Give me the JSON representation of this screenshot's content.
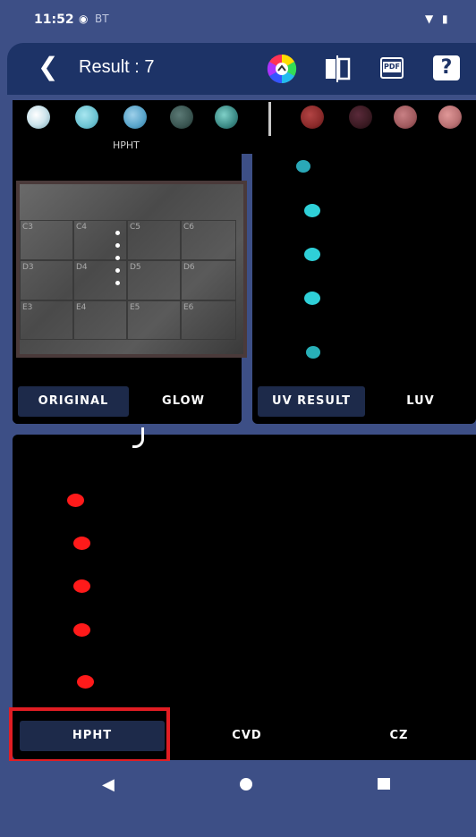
{
  "status": {
    "time": "11:52",
    "bt_label": "BT"
  },
  "header": {
    "back_icon": "chevron-left-icon",
    "title": "Result : 7",
    "icons": [
      "color-wheel-icon",
      "compare-icon",
      "pdf-icon",
      "help-icon"
    ],
    "pdf_label": "PDF",
    "help_label": "?"
  },
  "top_left_panel": {
    "label": "HPHT",
    "swatch_colors": [
      "#e6f2f6",
      "#6cc3d2",
      "#57a3c9",
      "#3a5551",
      "#3b8a85"
    ],
    "grid_cells": [
      "C3",
      "C4",
      "C5",
      "C6",
      "D3",
      "D4",
      "D5",
      "D6",
      "E3",
      "E4",
      "E5",
      "E6"
    ],
    "tabs": [
      "ORIGINAL",
      "GLOW"
    ],
    "active_tab": "ORIGINAL"
  },
  "top_right_panel": {
    "swatch_colors": [
      "#8a2a2a",
      "#3a1a22",
      "#a05a5e",
      "#b87072"
    ],
    "dot_color": "#2fd0d8",
    "tabs": [
      "UV RESULT",
      "LUV"
    ],
    "active_tab": "UV RESULT"
  },
  "bottom_panel": {
    "dot_color": "#ff1a1a",
    "tabs": [
      "HPHT",
      "CVD",
      "CZ"
    ],
    "active_tab": "HPHT"
  },
  "nav": {
    "icons": [
      "back-triangle-icon",
      "home-circle-icon",
      "recents-square-icon"
    ]
  }
}
